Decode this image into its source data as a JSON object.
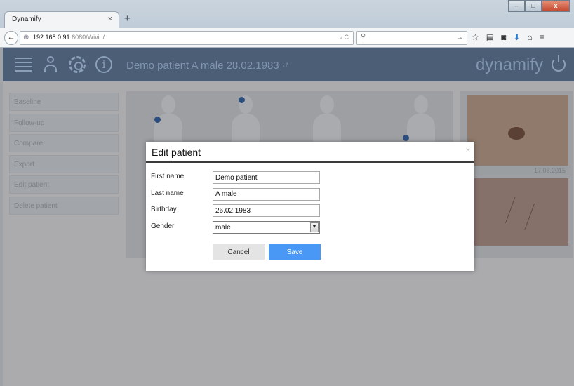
{
  "browser": {
    "tab_title": "Dynamify",
    "tab_close": "×",
    "new_tab": "+",
    "url_host": "192.168.0.91",
    "url_rest": ":8080/Wivid/",
    "window_buttons": [
      "–",
      "□",
      "x"
    ]
  },
  "app": {
    "patient_title": "Demo patient A male 28.02.1983 ♂",
    "brand": "dynamify",
    "sidebar": {
      "items": [
        {
          "label": "Baseline"
        },
        {
          "label": "Follow-up"
        },
        {
          "label": "Compare"
        },
        {
          "label": "Export"
        },
        {
          "label": "Edit patient"
        },
        {
          "label": "Delete patient"
        }
      ]
    },
    "photo_date": "17.08.2015"
  },
  "dialog": {
    "title": "Edit patient",
    "close": "×",
    "fields": {
      "first_name": {
        "label": "First name",
        "value": "Demo patient"
      },
      "last_name": {
        "label": "Last name",
        "value": "A male"
      },
      "birthday": {
        "label": "Birthday",
        "value": "26.02.1983"
      },
      "gender": {
        "label": "Gender",
        "value": "male"
      }
    },
    "cancel_label": "Cancel",
    "save_label": "Save"
  },
  "colors": {
    "appbar": "#4b5e76",
    "save_button": "#4a98f5",
    "overlay": "#ababad"
  }
}
